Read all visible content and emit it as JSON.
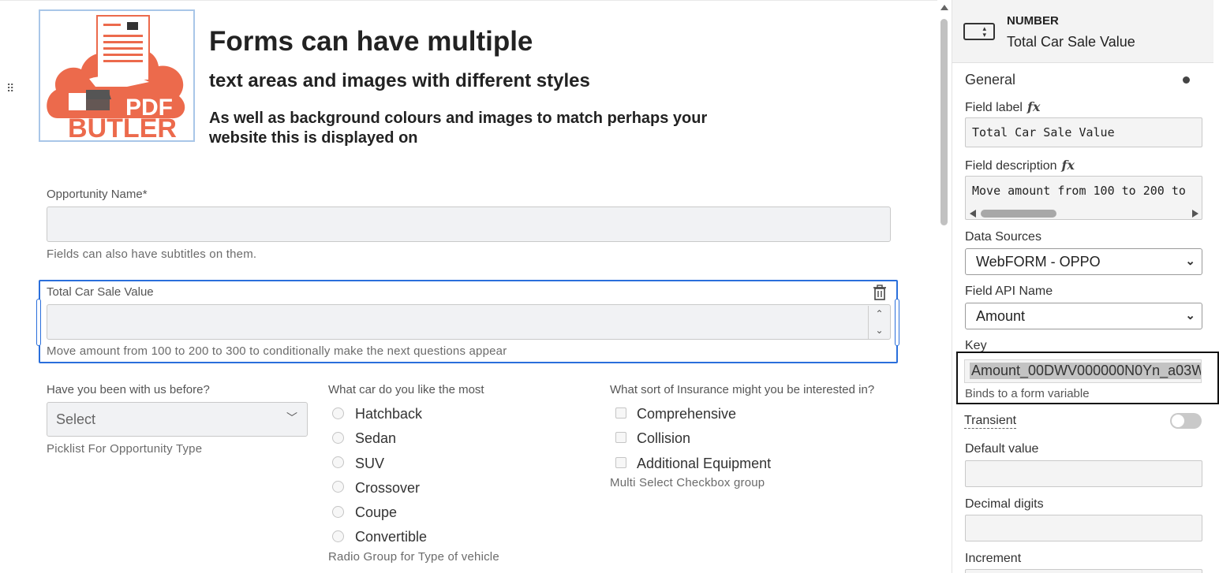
{
  "canvas": {
    "headline": "Forms can have multiple",
    "subhead": "text areas and images with different styles",
    "body": "As well as background colours and images to match perhaps your website this is displayed on",
    "logo_text_top": "PDF",
    "logo_text_bottom": "BUTLER"
  },
  "opportunity": {
    "label": "Opportunity Name*",
    "value": "",
    "subtitle": "Fields can also have subtitles on them."
  },
  "car_value": {
    "label": "Total Car Sale Value",
    "value": "",
    "subtitle": "Move amount from 100 to 200 to 300 to conditionally make the next questions appear",
    "spinner_up": "⌃",
    "spinner_down": "⌄"
  },
  "picklist": {
    "label": "Have you been with us before?",
    "selected": "Select",
    "subtitle": "Picklist For Opportunity Type"
  },
  "car_radio": {
    "label": "What car do you like the most",
    "options": [
      "Hatchback",
      "Sedan",
      "SUV",
      "Crossover",
      "Coupe",
      "Convertible"
    ],
    "subtitle": "Radio Group for Type of vehicle"
  },
  "insurance": {
    "label": "What sort of Insurance might you be interested in?",
    "options": [
      "Comprehensive",
      "Collision",
      "Additional Equipment"
    ],
    "subtitle": "Multi Select Checkbox group"
  },
  "panel": {
    "type": "NUMBER",
    "title": "Total Car Sale Value",
    "section": "General",
    "field_label": {
      "label": "Field label",
      "value": "Total Car Sale Value"
    },
    "field_description": {
      "label": "Field description",
      "value": "Move amount from 100 to 200 to"
    },
    "data_sources": {
      "label": "Data Sources",
      "value": "WebFORM - OPPO"
    },
    "api_name": {
      "label": "Field API Name",
      "value": "Amount"
    },
    "key": {
      "label": "Key",
      "value": "Amount_00DWV000000N0Yn_a03W",
      "hint": "Binds to a form variable"
    },
    "transient": {
      "label": "Transient",
      "on": false
    },
    "default_value": {
      "label": "Default value",
      "value": ""
    },
    "decimal_digits": {
      "label": "Decimal digits",
      "value": ""
    },
    "increment": {
      "label": "Increment"
    }
  },
  "colors": {
    "accent": "#2a6fdb",
    "logo_orange": "#ec6a4c",
    "input_bg": "#f1f2f4"
  },
  "icons": {
    "drag": "drag-handle-icon",
    "trash": "trash-icon",
    "number_type": "number-field-icon"
  }
}
